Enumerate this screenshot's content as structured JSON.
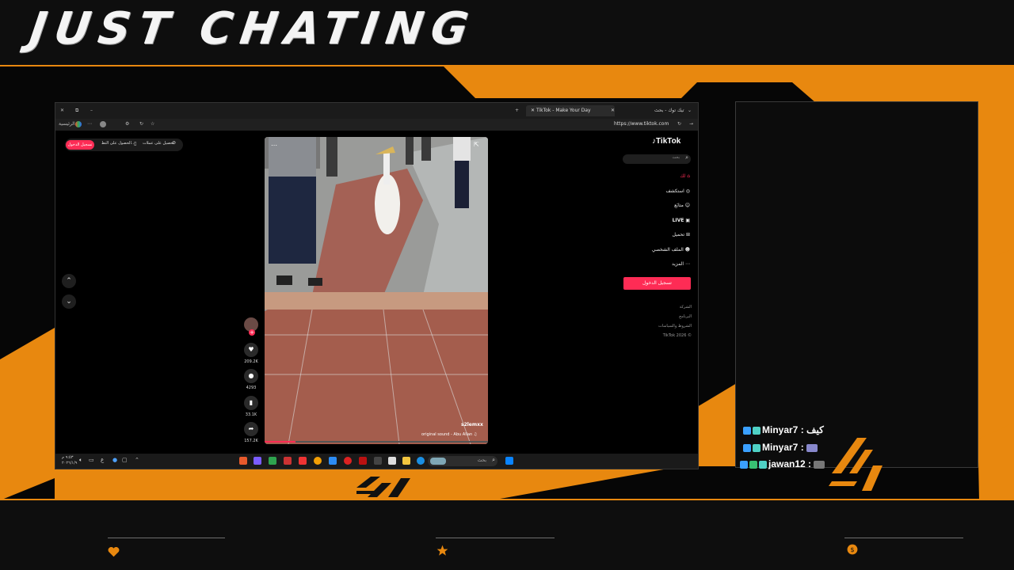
{
  "overlay": {
    "title": "JUST CHATING",
    "accent_color": "#e8880f",
    "footer_icons": [
      "heart-icon",
      "star-icon",
      "dollar-icon"
    ]
  },
  "browser": {
    "tabs": [
      {
        "label": "TikTok - Make Your Day",
        "active": true
      },
      {
        "label": "تيك توك - بحث",
        "active": false
      }
    ],
    "address": "https://www.tiktok.com",
    "bookmark_label": "الرئيسية"
  },
  "tiktok": {
    "logo": "TikTok",
    "search_placeholder": "بحث",
    "nav": [
      {
        "label": "لك",
        "icon": "home-icon"
      },
      {
        "label": "استكشف",
        "icon": "compass-icon"
      },
      {
        "label": "متابَع",
        "icon": "following-icon"
      },
      {
        "label": "LIVE",
        "icon": "live-icon"
      },
      {
        "label": "تحميل",
        "icon": "upload-icon"
      },
      {
        "label": "الملف الشخصي",
        "icon": "profile-icon"
      },
      {
        "label": "المزيد",
        "icon": "more-icon"
      }
    ],
    "login_button": "تسجيل الدخول",
    "footer_links": [
      "الشركة",
      "البرنامج",
      "الشروط والسياسات",
      "TikTok 2026 ©"
    ],
    "top_left": {
      "login_pill": "تسجيل الدخول",
      "get_app": "الحصول على التط...",
      "get_coins": "تحصيل على عملات"
    },
    "video": {
      "username": "s2lemxx",
      "sound": "original sound - Abu Allan ♫"
    },
    "actions": [
      {
        "icon": "heart-icon",
        "count": "209.2K"
      },
      {
        "icon": "comment-icon",
        "count": "4293"
      },
      {
        "icon": "bookmark-icon",
        "count": "33.1K"
      },
      {
        "icon": "share-icon",
        "count": "157.2K"
      }
    ]
  },
  "taskbar": {
    "search_placeholder": "بحث",
    "lang": "ع",
    "clock_time": "٩:٥٣ م",
    "clock_date": "٢٠٢٦/١/٩"
  },
  "chat": {
    "messages": [
      {
        "user": "Minyar7",
        "text": "كيف"
      },
      {
        "user": "Minyar7",
        "text": ""
      },
      {
        "user": "jawan12",
        "text": ""
      }
    ]
  }
}
